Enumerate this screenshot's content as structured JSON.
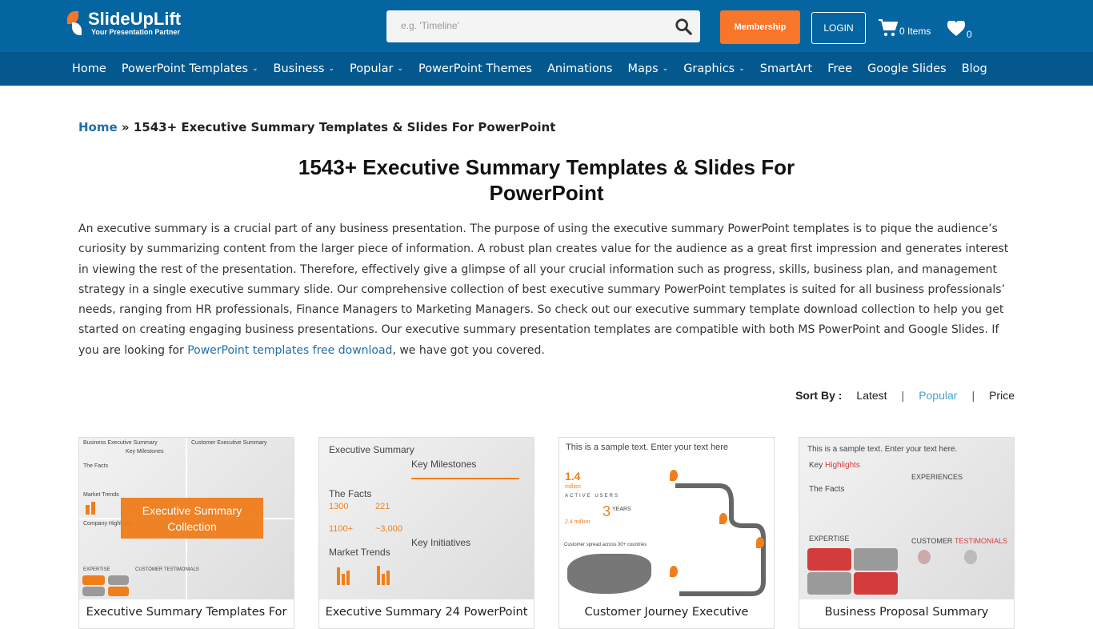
{
  "header": {
    "logo_title": "SlideUpLift",
    "logo_tagline": "Your Presentation Partner",
    "search_placeholder": "e.g. 'Timeline'",
    "membership": "Membership",
    "login": "LOGIN",
    "cart": "0 Items",
    "wishlist": "0"
  },
  "nav": [
    {
      "label": "Home",
      "dropdown": false
    },
    {
      "label": "PowerPoint Templates",
      "dropdown": true
    },
    {
      "label": "Business",
      "dropdown": true
    },
    {
      "label": "Popular",
      "dropdown": true
    },
    {
      "label": "PowerPoint Themes",
      "dropdown": false
    },
    {
      "label": "Animations",
      "dropdown": false
    },
    {
      "label": "Maps",
      "dropdown": true
    },
    {
      "label": "Graphics",
      "dropdown": true
    },
    {
      "label": "SmartArt",
      "dropdown": false
    },
    {
      "label": "Free",
      "dropdown": false
    },
    {
      "label": "Google Slides",
      "dropdown": false
    },
    {
      "label": "Blog",
      "dropdown": false
    }
  ],
  "breadcrumb": {
    "home": "Home",
    "sep": "»",
    "current": "1543+ Executive Summary Templates & Slides For PowerPoint"
  },
  "page_title": "1543+ Executive Summary Templates & Slides For PowerPoint",
  "description": {
    "text_before": "An executive summary is a crucial part of any business presentation. The purpose of using the executive summary PowerPoint templates is to pique the audience’s curiosity by summarizing content from the larger piece of information. A robust plan creates value for the audience as a great first impression and generates interest in viewing the rest of the presentation. Therefore, effectively give a glimpse of all your crucial information such as progress, skills, business plan, and management strategy in a single executive summary slide. Our comprehensive collection of best executive summary PowerPoint templates is suited for all business professionals’ needs, ranging from HR professionals, Finance Managers to Marketing Managers. So check out our executive summary template download collection to help you get started on creating engaging business presentations. Our executive summary presentation templates are compatible with both MS PowerPoint and Google Slides. If you are looking for ",
    "link": "PowerPoint templates free download",
    "text_after": ", we have got you covered."
  },
  "sort": {
    "label": "Sort By :",
    "options": [
      "Latest",
      "Popular",
      "Price"
    ],
    "active": "Popular"
  },
  "cards": [
    {
      "title": "Executive Summary Templates For",
      "overlay": "Executive Summary Collection",
      "thumb": {
        "a": "Business Executive Summary",
        "b": "Customer Executive Summary",
        "c": "Key Milestones",
        "d": "The Facts",
        "e": "Market Trends",
        "f": "Company Highlights",
        "g": "EXPERTISE",
        "h": "CUSTOMER TESTIMONIALS"
      }
    },
    {
      "title": "Executive Summary 24 PowerPoint",
      "thumb": {
        "heading": "Executive Summary",
        "milestones": "Key Milestones",
        "facts": "The Facts",
        "n1": "1300",
        "n2": "221",
        "n3": "1100+",
        "n4": "~3,000",
        "trends": "Market Trends",
        "initiatives": "Key Initiatives"
      }
    },
    {
      "title": "Customer Journey Executive",
      "thumb": {
        "heading": "This is a sample text. Enter your text here",
        "n1": "1.4",
        "n1u": "million",
        "active": "ACTIVE USERS",
        "years": "3",
        "years_label": "YEARS",
        "users": "2.4 million",
        "spread": "Customer spread across 30+ countries"
      }
    },
    {
      "title": "Business Proposal Summary",
      "thumb": {
        "heading": "This is a sample text. Enter your text here.",
        "key": "Key",
        "highlights": "Highlights",
        "facts": "The Facts",
        "experiences": "EXPERIENCES",
        "expertise": "EXPERTISE",
        "customer": "CUSTOMER",
        "testimonials": "TESTIMONIALS"
      }
    }
  ],
  "colors": {
    "header": "#0565a0",
    "nav": "#05588e",
    "accent": "#f7762a",
    "link": "#1f6fa8"
  }
}
